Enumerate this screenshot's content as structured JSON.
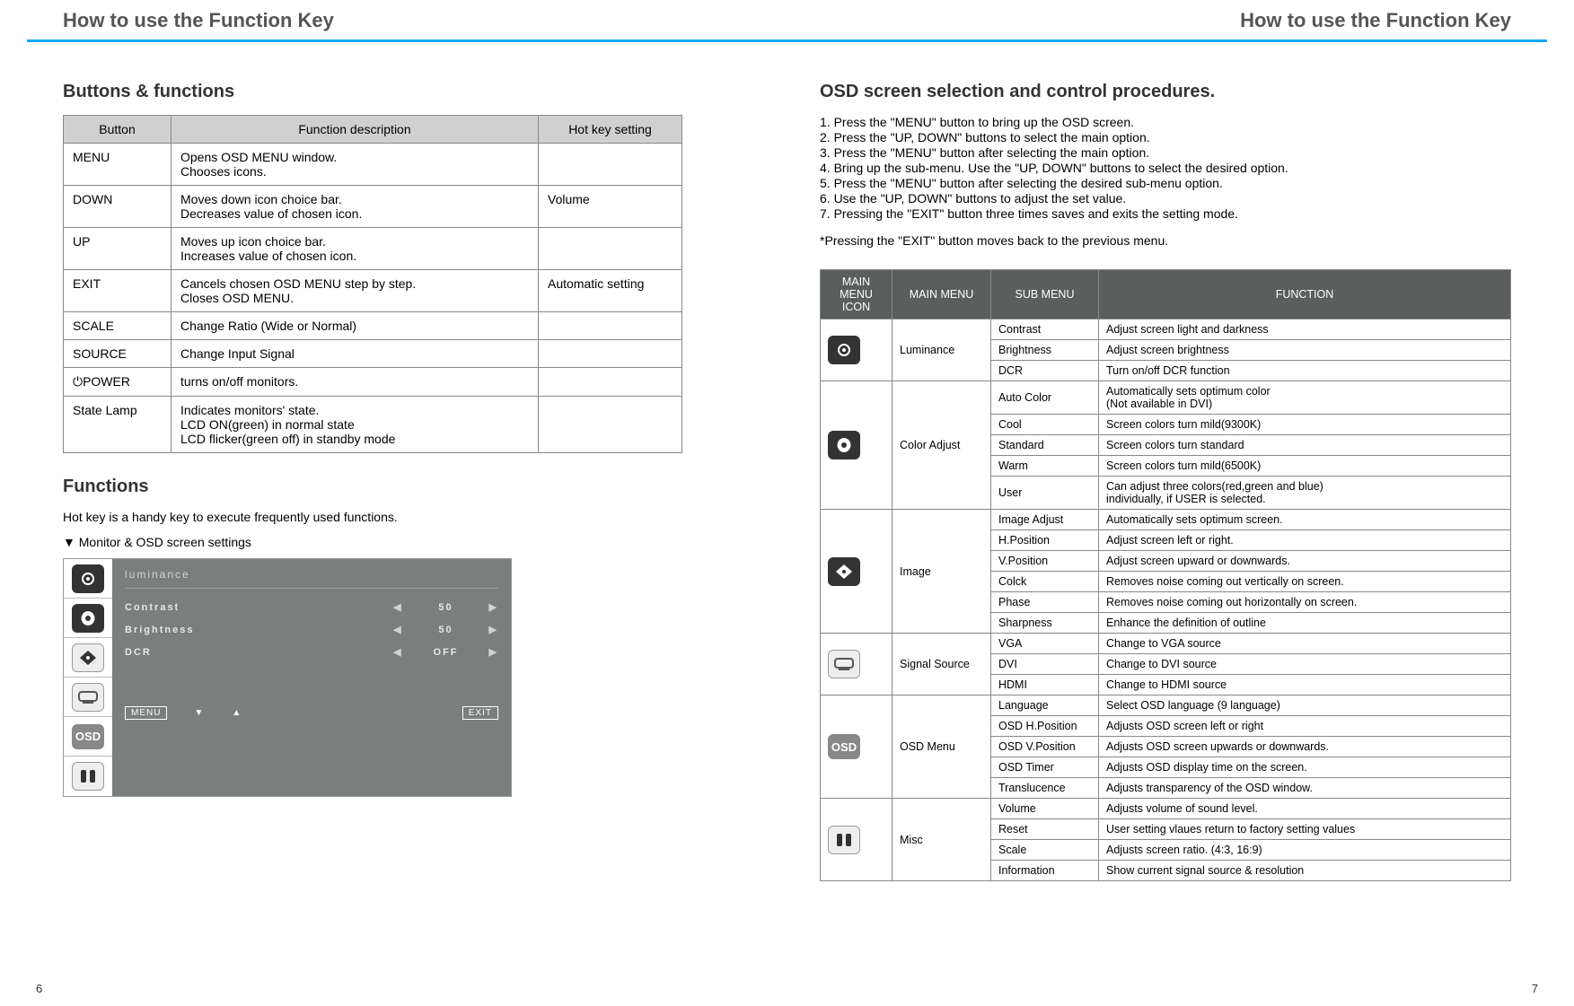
{
  "header": {
    "left": "How to use the Function Key",
    "right": "How to use the Function Key"
  },
  "pages": {
    "left": "6",
    "right": "7"
  },
  "left": {
    "section1_title": "Buttons & functions",
    "buttons_table": {
      "headers": [
        "Button",
        "Function description",
        "Hot key setting"
      ],
      "rows": [
        {
          "button": "MENU",
          "desc": "Opens OSD MENU window.\nChooses icons.",
          "hotkey": ""
        },
        {
          "button": "DOWN",
          "desc": "Moves down icon choice bar.\nDecreases value of chosen icon.",
          "hotkey": "Volume"
        },
        {
          "button": "UP",
          "desc": "Moves up icon choice bar.\nIncreases value of chosen icon.",
          "hotkey": ""
        },
        {
          "button": "EXIT",
          "desc": "Cancels chosen OSD MENU step by step.\nCloses OSD MENU.",
          "hotkey": "Automatic setting"
        },
        {
          "button": "SCALE",
          "desc": "Change Ratio (Wide or Normal)",
          "hotkey": ""
        },
        {
          "button": "SOURCE",
          "desc": "Change Input Signal",
          "hotkey": ""
        },
        {
          "button": "⏻POWER",
          "desc": "turns on/off monitors.",
          "hotkey": ""
        },
        {
          "button": "State Lamp",
          "desc": "Indicates monitors' state.\nLCD ON(green) in normal state\nLCD flicker(green off) in standby mode",
          "hotkey": ""
        }
      ]
    },
    "section2_title": "Functions",
    "section2_sub": "Hot key is a handy key to execute frequently used functions.",
    "osd_heading": "▼ Monitor & OSD screen settings",
    "osd": {
      "title": "luminance",
      "rows": [
        {
          "label": "Contrast",
          "left": "◀",
          "val": "50",
          "right": "▶"
        },
        {
          "label": "Brightness",
          "left": "◀",
          "val": "50",
          "right": "▶"
        },
        {
          "label": "DCR",
          "left": "◀",
          "val": "OFF",
          "right": "▶"
        }
      ],
      "footer": {
        "menu": "MENU",
        "down": "▼",
        "up": "▲",
        "exit": "EXIT"
      }
    }
  },
  "right": {
    "title": "OSD screen selection and control procedures.",
    "steps": [
      "1. Press the \"MENU\" button to bring up the OSD screen.",
      "2. Press the \"UP, DOWN\" buttons to select the main option.",
      "3. Press the \"MENU\" button after selecting the main option.",
      "4. Bring up the sub-menu. Use the \"UP, DOWN\" buttons to select the desired option.",
      "5. Press the \"MENU\" button after selecting the desired sub-menu option.",
      "6. Use the \"UP, DOWN\" buttons to adjust the set value.",
      "7. Pressing the \"EXIT\" button three times saves and exits the setting mode."
    ],
    "note": "*Pressing the \"EXIT\" button moves back to the previous menu.",
    "osd_table": {
      "headers": [
        "MAIN MENU ICON",
        "MAIN MENU",
        "SUB MENU",
        "FUNCTION"
      ],
      "groups": [
        {
          "icon": "luminance-icon",
          "main": "Luminance",
          "rows": [
            {
              "sub": "Contrast",
              "func": "Adjust screen light and darkness"
            },
            {
              "sub": "Brightness",
              "func": "Adjust screen brightness"
            },
            {
              "sub": "DCR",
              "func": "Turn on/off DCR function"
            }
          ]
        },
        {
          "icon": "color-adjust-icon",
          "main": "Color Adjust",
          "rows": [
            {
              "sub": "Auto Color",
              "func": "Automatically sets optimum color\n(Not available in DVI)"
            },
            {
              "sub": "Cool",
              "func": "Screen colors turn mild(9300K)"
            },
            {
              "sub": "Standard",
              "func": "Screen colors turn standard"
            },
            {
              "sub": "Warm",
              "func": "Screen colors turn mild(6500K)"
            },
            {
              "sub": "User",
              "func": "Can adjust three colors(red,green and blue)\nindividually, if USER is selected."
            }
          ]
        },
        {
          "icon": "image-icon",
          "main": "Image",
          "rows": [
            {
              "sub": "Image Adjust",
              "func": "Automatically sets optimum screen."
            },
            {
              "sub": "H.Position",
              "func": "Adjust screen left or right."
            },
            {
              "sub": "V.Position",
              "func": "Adjust screen upward or downwards."
            },
            {
              "sub": "Colck",
              "func": "Removes noise coming out vertically on screen."
            },
            {
              "sub": "Phase",
              "func": "Removes noise coming out horizontally on screen."
            },
            {
              "sub": "Sharpness",
              "func": "Enhance the definition of outline"
            }
          ]
        },
        {
          "icon": "signal-source-icon",
          "main": "Signal Source",
          "rows": [
            {
              "sub": "VGA",
              "func": "Change to VGA source"
            },
            {
              "sub": "DVI",
              "func": "Change to DVI source"
            },
            {
              "sub": "HDMI",
              "func": "Change to HDMI source"
            }
          ]
        },
        {
          "icon": "osd-menu-icon",
          "main": "OSD Menu",
          "rows": [
            {
              "sub": "Language",
              "func": "Select OSD language (9 language)"
            },
            {
              "sub": "OSD H.Position",
              "func": "Adjusts OSD screen left or right"
            },
            {
              "sub": "OSD V.Position",
              "func": "Adjusts OSD screen upwards or downwards."
            },
            {
              "sub": "OSD Timer",
              "func": "Adjusts OSD display time on the screen."
            },
            {
              "sub": "Translucence",
              "func": "Adjusts transparency of the OSD window."
            }
          ]
        },
        {
          "icon": "misc-icon",
          "main": "Misc",
          "rows": [
            {
              "sub": "Volume",
              "func": "Adjusts volume of sound level."
            },
            {
              "sub": "Reset",
              "func": "User setting vlaues return to factory setting values"
            },
            {
              "sub": "Scale",
              "func": "Adjusts screen ratio. (4:3, 16:9)"
            },
            {
              "sub": "Information",
              "func": "Show current signal source & resolution"
            }
          ]
        }
      ]
    }
  }
}
